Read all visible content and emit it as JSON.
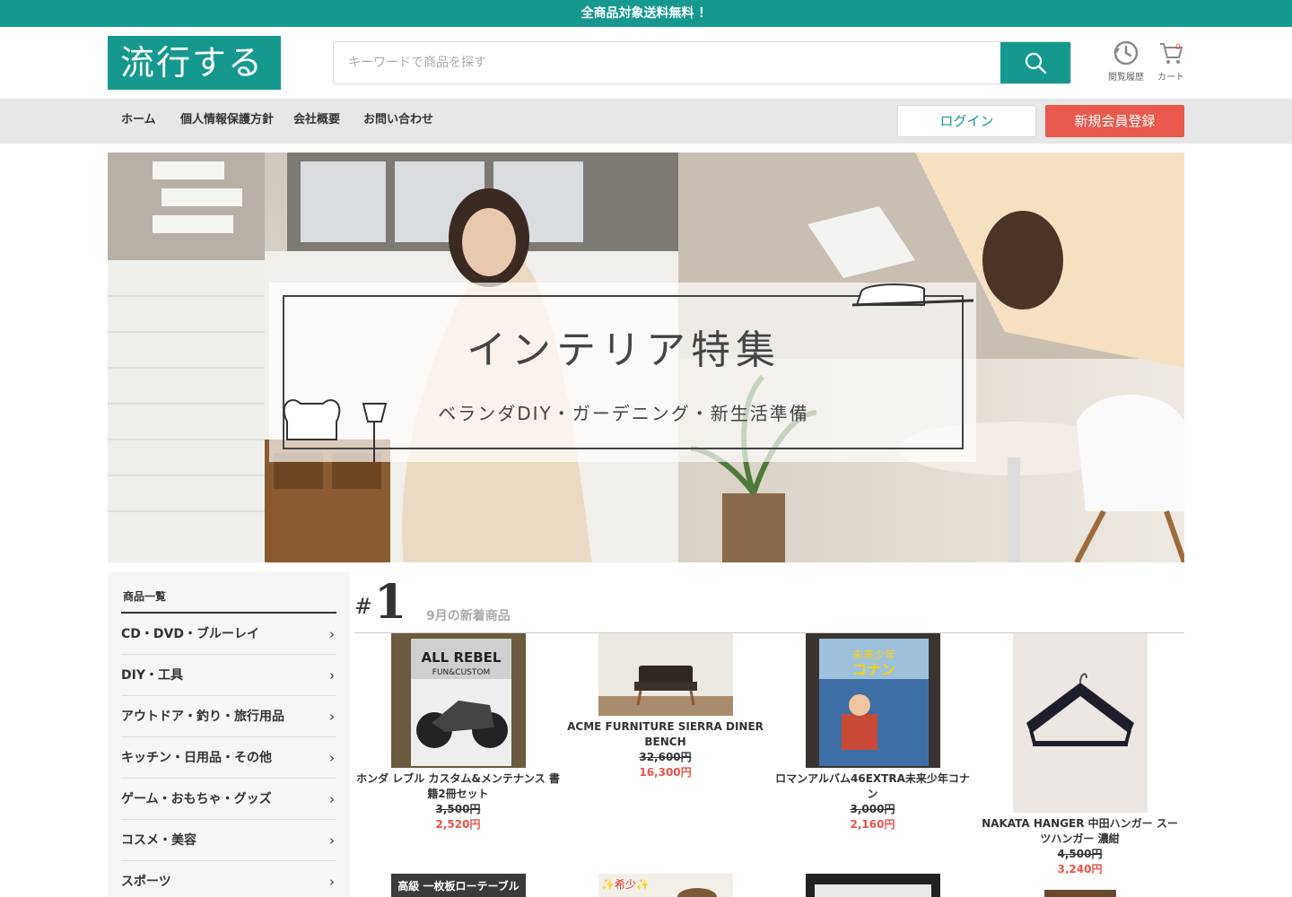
{
  "topbar": {
    "text": "全商品対象送料無料 ！"
  },
  "header": {
    "logo": "流行する",
    "search_placeholder": "キーワードで商品を探す",
    "history_label": "閲覧履歴",
    "cart_label": "カート",
    "cart_count": "0"
  },
  "nav": {
    "items": [
      "ホーム",
      "個人情報保護方針",
      "会社概要",
      "お問い合わせ"
    ],
    "login": "ログイン",
    "register": "新規会員登録"
  },
  "banner": {
    "title": "インテリア特集",
    "subtitle": "ベランダDIY・ガーデニング・新生活準備"
  },
  "sidebar": {
    "title": "商品一覧",
    "categories": [
      "CD・DVD・ブルーレイ",
      "DIY・工具",
      "アウトドア・釣り・旅行用品",
      "キッチン・日用品・その他",
      "ゲーム・おもちゃ・グッズ",
      "コスメ・美容",
      "スポーツ"
    ],
    "chevron": "›"
  },
  "section": {
    "hash": "#",
    "number": "1",
    "subtitle": "9月の新着商品"
  },
  "products": [
    {
      "name": "ホンダ レブル カスタム&メンテナンス 書籍2冊セット",
      "old_price": "3,500円",
      "price": "2,520円",
      "image_text_1": "ALL REBEL",
      "image_text_2": "FUN&CUSTOM"
    },
    {
      "name": "ACME FURNITURE SIERRA DINER BENCH",
      "old_price": "32,600円",
      "price": "16,300円"
    },
    {
      "name": "ロマンアルバム46EXTRA未来少年コナン",
      "old_price": "3,000円",
      "price": "2,160円",
      "image_text_1": "未来少年",
      "image_text_2": "コナン"
    },
    {
      "name": "NAKATA HANGER 中田ハンガー スーツハンガー 濃紺",
      "old_price": "4,500円",
      "price": "3,240円"
    }
  ],
  "products_row2": [
    {
      "image_text": "高級 一枚板ローテーブル"
    },
    {
      "image_text": "✨希少✨"
    },
    {
      "image_text": ""
    },
    {
      "image_text": ""
    }
  ]
}
